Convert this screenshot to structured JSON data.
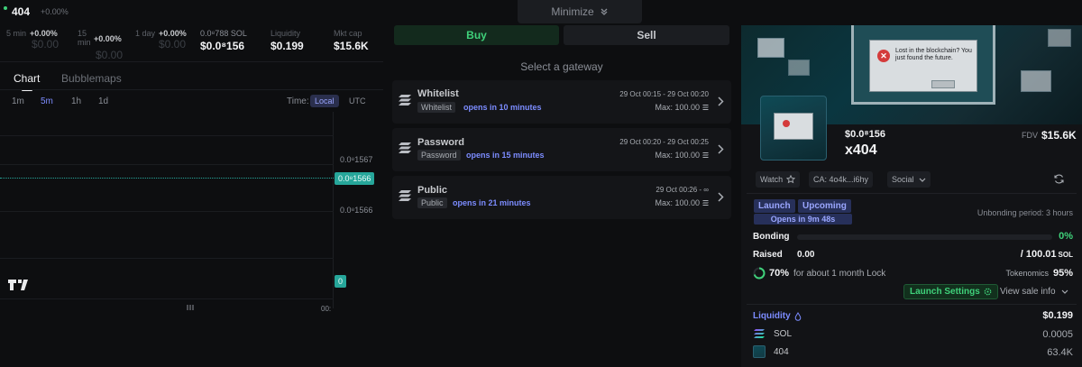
{
  "header": {
    "ticker": "404",
    "change": "+0.00%",
    "minimize_label": "Minimize"
  },
  "stats": {
    "tf_5min": {
      "label": "5 min",
      "pct": "+0.00%",
      "value": "$0.00"
    },
    "tf_15min": {
      "label1": "15",
      "label2": "min",
      "pct": "+0.00%",
      "value": "$0.00"
    },
    "tf_1day": {
      "label": "1 day",
      "pct": "+0.00%",
      "value": "$0.00"
    },
    "price_sol": {
      "label": "0.0⁸788 SOL",
      "value": "$0.0⁸156"
    },
    "liquidity": {
      "label": "Liquidity",
      "value": "$0.199"
    },
    "mktcap": {
      "label": "Mkt cap",
      "value": "$15.6K"
    }
  },
  "chart_tabs": [
    "Chart",
    "Bubblemaps"
  ],
  "timeframes": [
    "1m",
    "5m",
    "1h",
    "1d"
  ],
  "active_timeframe": "5m",
  "time_label": "Time:",
  "time_zones": [
    "Local",
    "UTC"
  ],
  "chart": {
    "price_labels": [
      "0.0⁸1567",
      "0.0⁸1566",
      "0.0⁸1566"
    ],
    "volume_tag": "0",
    "x_tick": "00:",
    "logo": "TV"
  },
  "trade": {
    "buy_label": "Buy",
    "sell_label": "Sell",
    "gateway_title": "Select a gateway",
    "gateways": [
      {
        "name": "Whitelist",
        "tag": "Whitelist",
        "opens": "opens in 10 minutes",
        "dates": "29 Oct 00:15 - 29 Oct 00:20",
        "max": "Max: 100.00"
      },
      {
        "name": "Password",
        "tag": "Password",
        "opens": "opens in 15 minutes",
        "dates": "29 Oct 00:20 - 29 Oct 00:25",
        "max": "Max: 100.00"
      },
      {
        "name": "Public",
        "tag": "Public",
        "opens": "opens in 21 minutes",
        "dates": "29 Oct 00:26 - ∞",
        "max": "Max: 100.00"
      }
    ]
  },
  "token": {
    "price": "$0.0⁸156",
    "name": "x404",
    "fdv_label": "FDV",
    "fdv_value": "$15.6K",
    "banner_text": "Lost in the blockchain? You just found the future.",
    "watch_label": "Watch",
    "ca_label": "CA: 4o4k...i6hy",
    "social_label": "Social",
    "tag_launch": "Launch",
    "tag_upcoming": "Upcoming",
    "opens_in": "Opens in 9m 48s",
    "unbonding": "Unbonding period: 3 hours",
    "bonding_label": "Bonding",
    "bonding_pct": "0%",
    "bonding_progress": 0,
    "raised_label": "Raised",
    "raised_value": "0.00",
    "raised_total": "/ 100.01",
    "raised_unit": "SOL",
    "lock_pct": "70%",
    "lock_text": "for about 1 month Lock",
    "lock_progress": 0.7,
    "tokenomics_label": "Tokenomics",
    "tokenomics_value": "95%",
    "launch_settings": "Launch Settings",
    "view_sale_info": "View sale info",
    "liquidity_label": "Liquidity",
    "liquidity_value": "$0.199",
    "liq_rows": [
      {
        "symbol": "SOL",
        "value": "0.0005"
      },
      {
        "symbol": "404",
        "value": "63.4K"
      }
    ]
  },
  "colors": {
    "accent_green": "#3fd17a",
    "accent_blue": "#7c8cff",
    "price_line": "#26a69a"
  }
}
